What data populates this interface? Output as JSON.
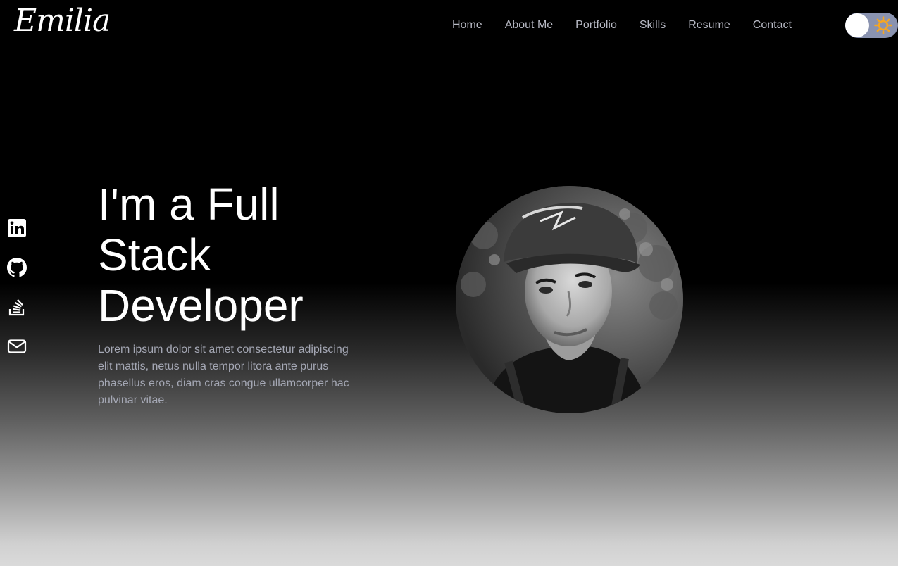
{
  "header": {
    "logo": "Emilia",
    "nav": [
      "Home",
      "About Me",
      "Portfolio",
      "Skills",
      "Resume",
      "Contact"
    ]
  },
  "theme_toggle": {
    "icon": "sun-icon",
    "state": "light",
    "sun_color": "#f5a623"
  },
  "social": [
    {
      "name": "linkedin",
      "icon": "linkedin-icon"
    },
    {
      "name": "github",
      "icon": "github-icon"
    },
    {
      "name": "stack-overflow",
      "icon": "stack-overflow-icon"
    },
    {
      "name": "email",
      "icon": "mail-icon"
    }
  ],
  "hero": {
    "title_lines": [
      "I'm a Full",
      "Stack",
      "Developer"
    ],
    "description": "Lorem ipsum dolor sit amet consectetur adipiscing elit mattis, netus nulla tempor litora ante purus phasellus eros, diam cras congue ullamcorper hac pulvinar vitae."
  }
}
